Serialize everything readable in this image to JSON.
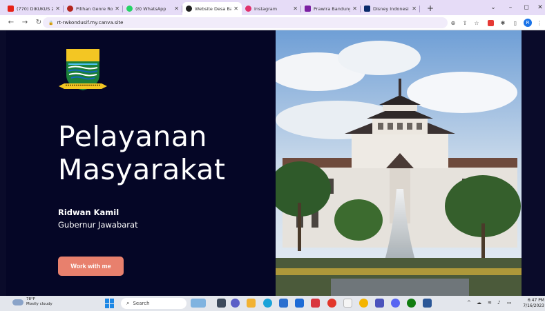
{
  "browser": {
    "tabs": [
      {
        "label": "(770) DIKUKUS 2",
        "color": "#e62117",
        "round": false
      },
      {
        "label": "Pilihan Genre Ro",
        "color": "#b3261e",
        "round": true
      },
      {
        "label": "(8) WhatsApp",
        "color": "#25d366",
        "round": true
      },
      {
        "label": "Website Desa Ba",
        "color": "#1f1f1f",
        "round": true,
        "active": true
      },
      {
        "label": "Instagram",
        "color": "#e1306c",
        "round": true
      },
      {
        "label": "Prawira Bandung",
        "color": "#7b1fa2",
        "round": false
      },
      {
        "label": "Disney Indonesi",
        "color": "#0a2a6b",
        "round": false
      }
    ],
    "new_tab": "+",
    "url": "rt-rwkondusif.my.canva.site",
    "profile_initial": "R"
  },
  "page": {
    "headline": [
      "Pelayanan",
      "Masyarakat"
    ],
    "person_name": "Ridwan Kamil",
    "person_role": "Gubernur Jawabarat",
    "cta_label": "Work with me",
    "accent": "#e8806d",
    "panel_bg": "#050626"
  },
  "taskbar": {
    "weather_temp": "78°F",
    "weather_desc": "Mostly cloudy",
    "search_label": "Search",
    "time": "6:47 PM",
    "date": "7/16/2023"
  }
}
